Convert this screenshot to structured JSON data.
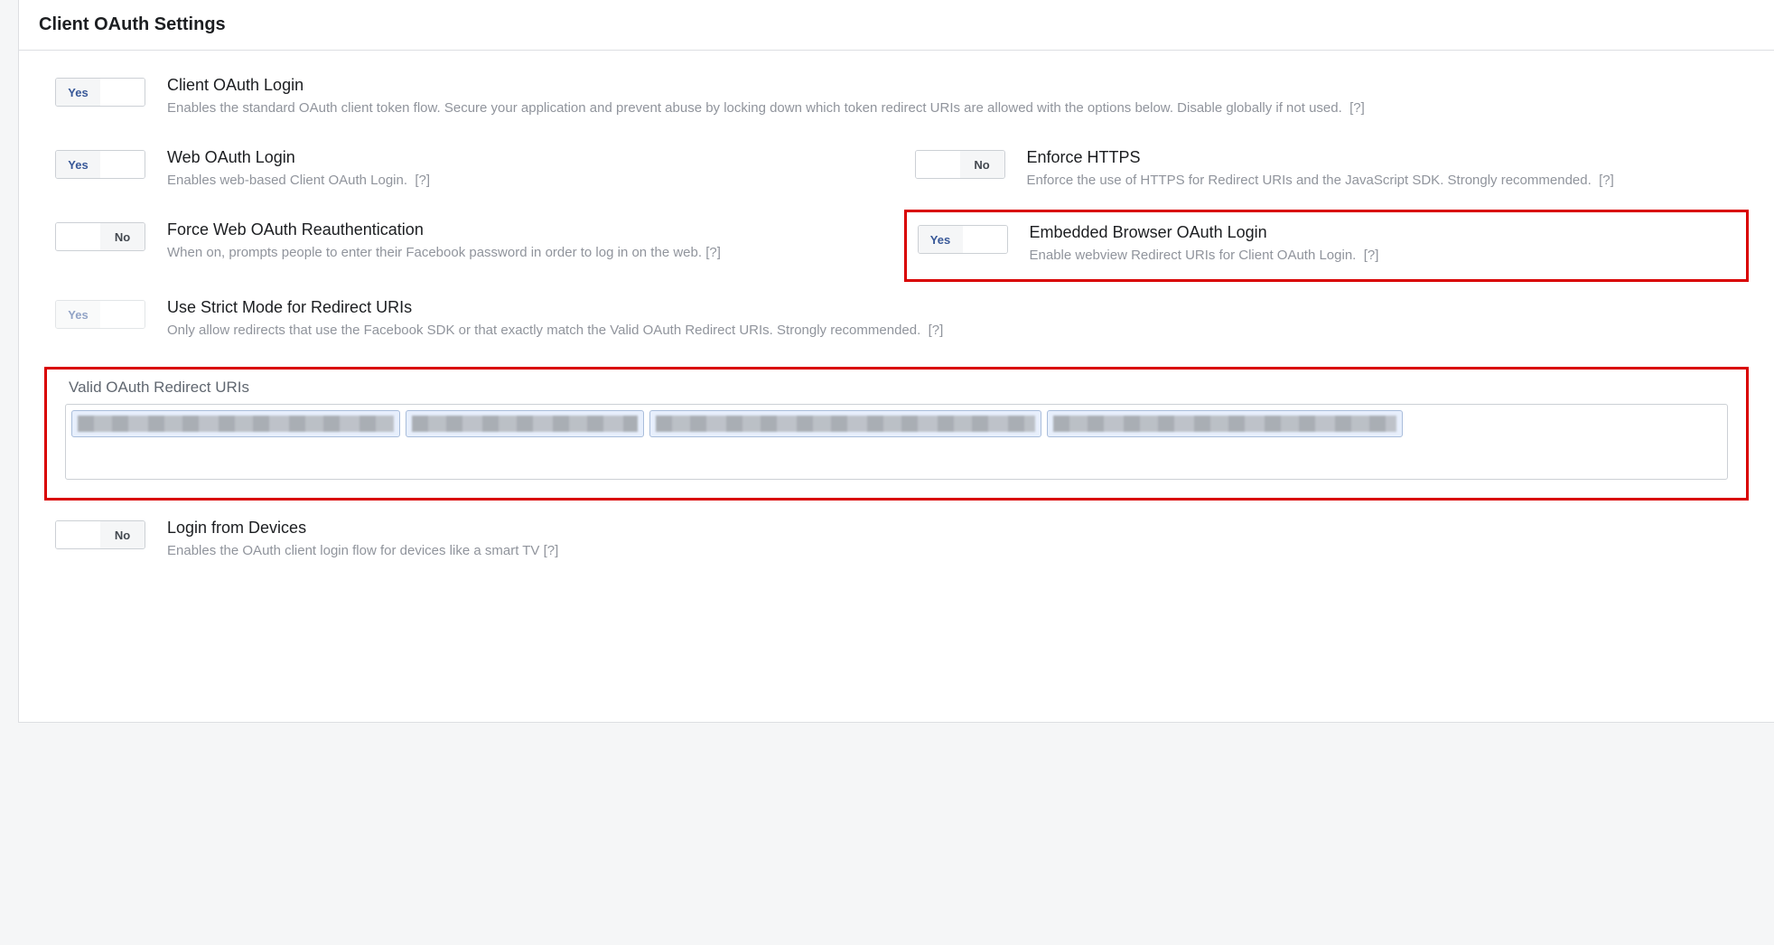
{
  "toggle": {
    "yes": "Yes",
    "no": "No"
  },
  "help": "[?]",
  "panel": {
    "title": "Client OAuth Settings"
  },
  "settings": {
    "client_oauth_login": {
      "title": "Client OAuth Login",
      "desc": "Enables the standard OAuth client token flow. Secure your application and prevent abuse by locking down which token redirect URIs are allowed with the options below. Disable globally if not used.",
      "state": "on"
    },
    "web_oauth_login": {
      "title": "Web OAuth Login",
      "desc": "Enables web-based Client OAuth Login.",
      "state": "on"
    },
    "enforce_https": {
      "title": "Enforce HTTPS",
      "desc": "Enforce the use of HTTPS for Redirect URIs and the JavaScript SDK. Strongly recommended.",
      "state": "off"
    },
    "force_reauth": {
      "title": "Force Web OAuth Reauthentication",
      "desc": "When on, prompts people to enter their Facebook password in order to log in on the web.",
      "state": "off"
    },
    "embedded_browser": {
      "title": "Embedded Browser OAuth Login",
      "desc": "Enable webview Redirect URIs for Client OAuth Login.",
      "state": "on"
    },
    "strict_mode": {
      "title": "Use Strict Mode for Redirect URIs",
      "desc": "Only allow redirects that use the Facebook SDK or that exactly match the Valid OAuth Redirect URIs. Strongly recommended.",
      "state": "on",
      "disabled": true
    },
    "login_from_devices": {
      "title": "Login from Devices",
      "desc": "Enables the OAuth client login flow for devices like a smart TV",
      "state": "off"
    }
  },
  "redirect_uris": {
    "label": "Valid OAuth Redirect URIs",
    "tag_widths": [
      350,
      250,
      420,
      380
    ]
  }
}
